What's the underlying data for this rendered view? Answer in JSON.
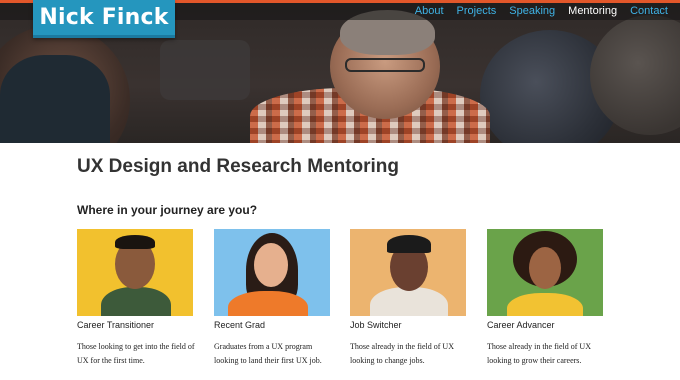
{
  "site": {
    "logo": "Nick Finck",
    "nav": [
      {
        "label": "About",
        "active": false
      },
      {
        "label": "Projects",
        "active": false
      },
      {
        "label": "Speaking",
        "active": false
      },
      {
        "label": "Mentoring",
        "active": true
      },
      {
        "label": "Contact",
        "active": false
      }
    ],
    "accent": "#2596be",
    "topbar_color": "#e2572a"
  },
  "main": {
    "title": "UX Design and Research Mentoring",
    "subtitle": "Where in your journey are you?",
    "cards": [
      {
        "name": "Career Transitioner",
        "description": "Those looking to get into the field of UX for the first time.",
        "photo_bg": "#f2c12e"
      },
      {
        "name": "Recent Grad",
        "description": "Graduates from a UX program looking to land their first UX job.",
        "photo_bg": "#7ec1ec"
      },
      {
        "name": "Job Switcher",
        "description": "Those already in the field of UX looking to change jobs.",
        "photo_bg": "#ecb46f"
      },
      {
        "name": "Career Advancer",
        "description": "Those already in the field of UX looking to grow their careers.",
        "photo_bg": "#6aa34a"
      }
    ]
  }
}
